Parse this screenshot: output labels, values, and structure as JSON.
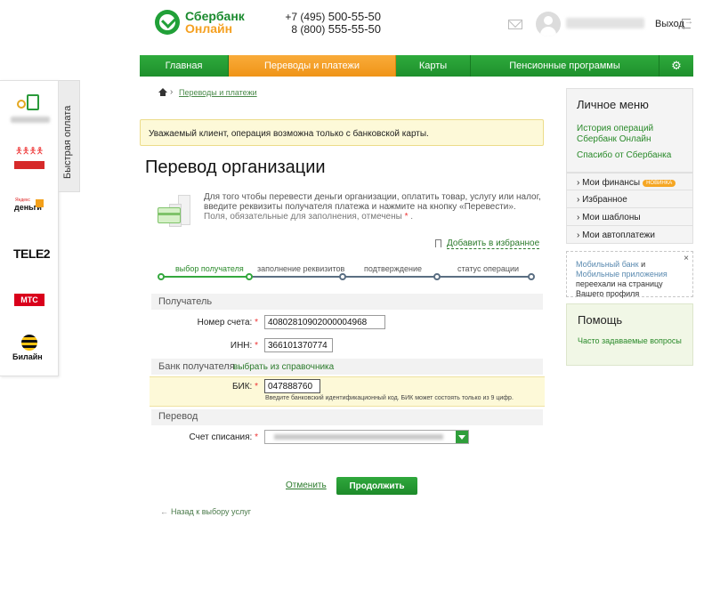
{
  "header": {
    "logo_line1": "Сбербанк",
    "logo_line2": "Онлайн",
    "phone1_prefix": "+7 (495) ",
    "phone1_number": "500-55-50",
    "phone2_prefix": "8 (800) ",
    "phone2_number": "555-55-50",
    "logout_label": "Выход"
  },
  "nav": {
    "items": [
      {
        "label": "Главная",
        "active": false
      },
      {
        "label": "Переводы и платежи",
        "active": true
      },
      {
        "label": "Карты",
        "active": false
      },
      {
        "label": "Пенсионные программы",
        "active": false
      }
    ]
  },
  "quick_pay": {
    "tab_label": "Быстрая оплата",
    "items": [
      "mobile-tablet-icon",
      "kids-charity-logo",
      "yandex-money-logo",
      "tele2-logo",
      "mts-logo",
      "beeline-logo"
    ],
    "yandex_small": "Яндекс",
    "yandex_text": "деньги",
    "tele2_text": "TELE2",
    "mts_text": "МТС",
    "beeline_text": "Билайн"
  },
  "breadcrumb": {
    "link": "Переводы и платежи"
  },
  "notice": "Уважаемый клиент, операция возможна только с банковской карты.",
  "page_title": "Перевод организации",
  "info": {
    "text": "Для того чтобы перевести деньги организации, оплатить товар, услугу или налог, введите реквизиты получателя платежа и нажмите на кнопку «Перевести».",
    "required_text": "Поля, обязательные для заполнения, отмечены",
    "required_star": "*",
    "required_end": "."
  },
  "favorites_link": "Добавить в избранное",
  "steps": [
    {
      "label": "выбор получателя",
      "active": true
    },
    {
      "label": "заполнение реквизитов",
      "active": false
    },
    {
      "label": "подтверждение",
      "active": false
    },
    {
      "label": "статус операции",
      "active": false
    }
  ],
  "form": {
    "section_recipient": "Получатель",
    "account_label": "Номер счета:",
    "account_value": "40802810902000004968",
    "inn_label": "ИНН:",
    "inn_value": "366101370774",
    "section_bank": "Банк получателя",
    "dict_link": "выбрать из справочника",
    "bik_label": "БИК:",
    "bik_value": "047888760",
    "bik_hint": "Введите банковский идентификационный код. БИК может состоять только из 9 цифр.",
    "section_transfer": "Перевод",
    "debit_label": "Счет списания:",
    "required_star": "*"
  },
  "actions": {
    "cancel": "Отменить",
    "continue": "Продолжить",
    "back": "Назад к выбору услуг"
  },
  "personal_menu": {
    "title": "Личное меню",
    "links": [
      "История операций Сбербанк Онлайн",
      "Спасибо от Сбербанка"
    ],
    "items": [
      "Мои финансы",
      "Избранное",
      "Мои шаблоны",
      "Мои автоплатежи"
    ],
    "badge": "НОВИНКА"
  },
  "promo": {
    "link1": "Мобильный банк",
    "and": " и ",
    "link2": "Мобильные приложения",
    "rest": " переехали на страницу Вашего профиля",
    "close": "×"
  },
  "help": {
    "title": "Помощь",
    "link": "Часто задаваемые вопросы"
  },
  "colors": {
    "brand_green": "#21a038",
    "accent_orange": "#f5a020",
    "notice_bg": "#fdf9d8"
  }
}
